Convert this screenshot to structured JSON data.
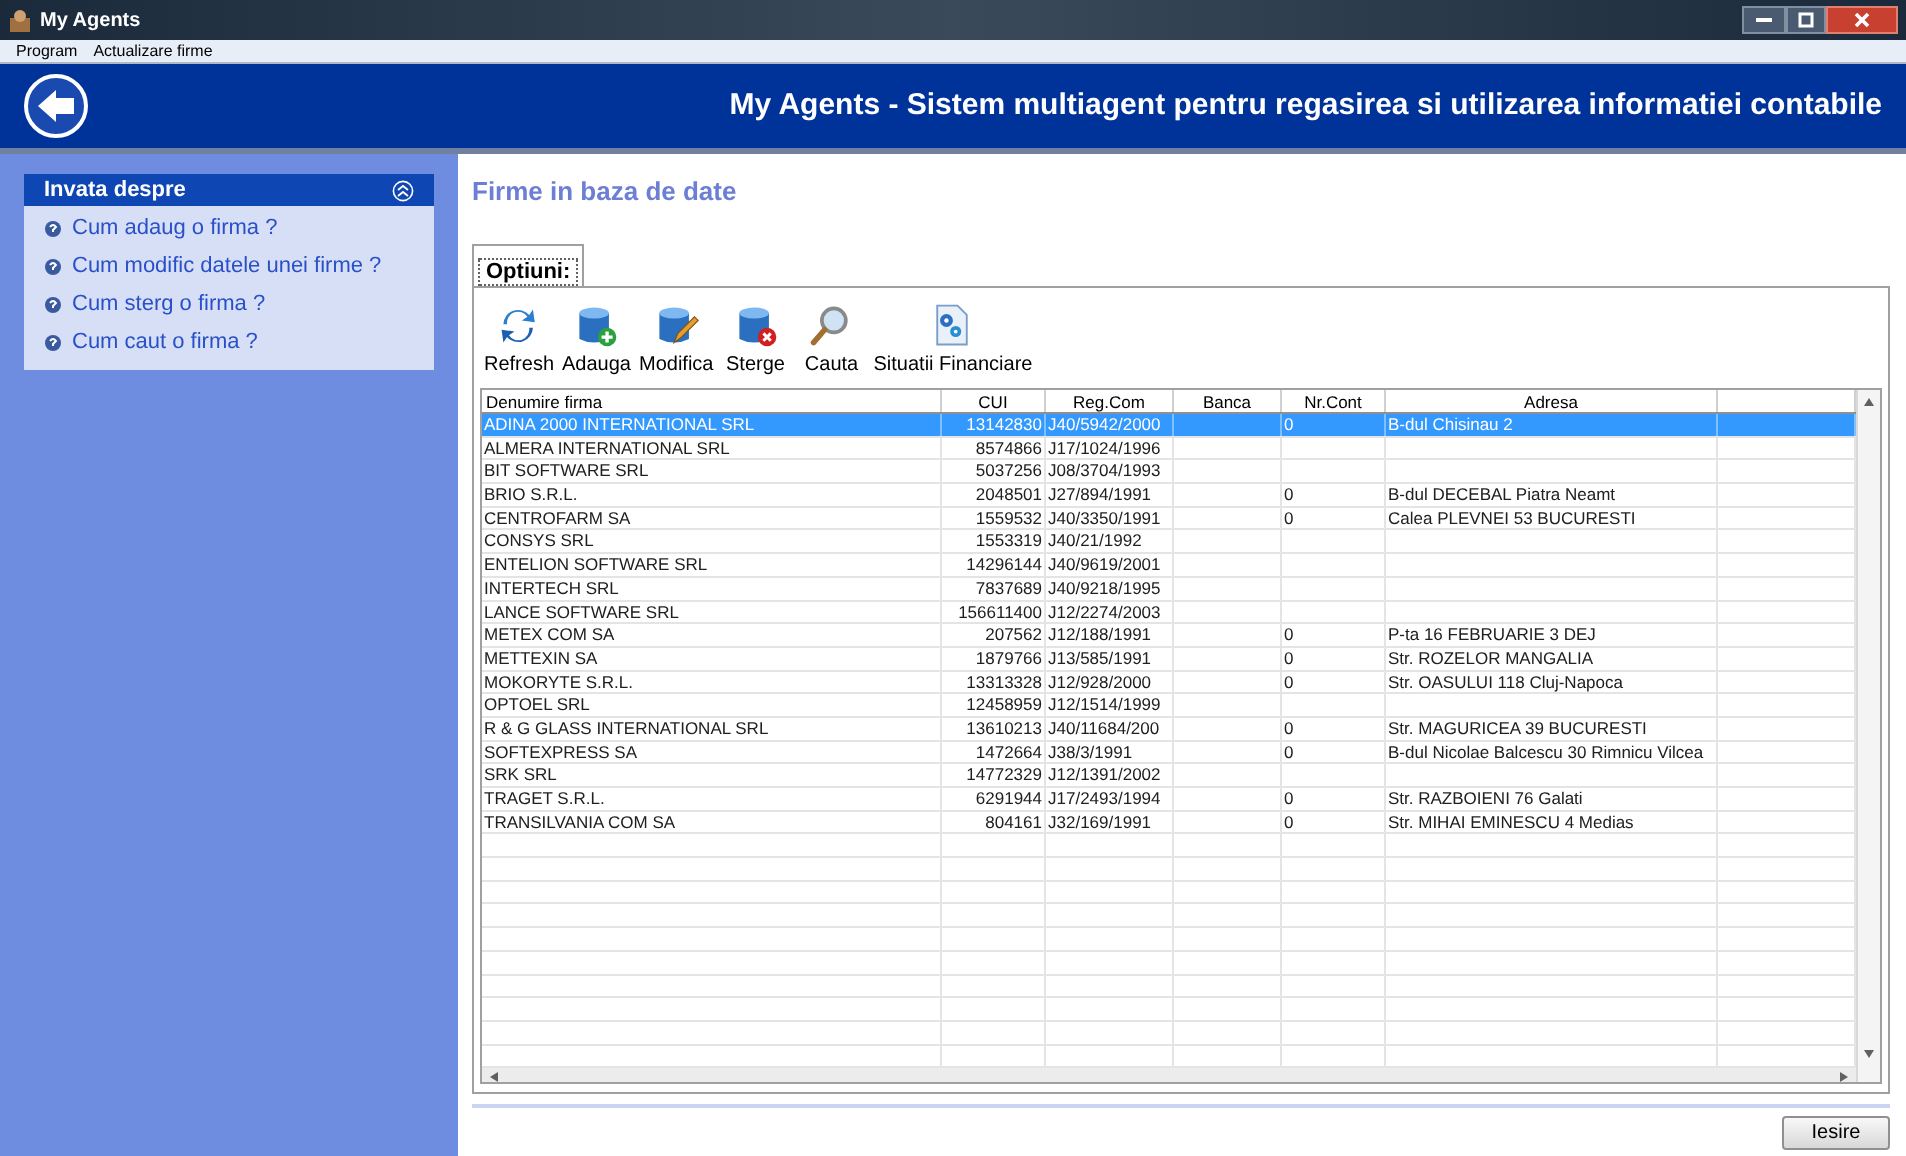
{
  "window": {
    "title": "My Agents"
  },
  "menu": [
    "Program",
    "Actualizare firme"
  ],
  "header": {
    "title": "My Agents - Sistem multiagent pentru regasirea si utilizarea informatiei contabile"
  },
  "sidebar": {
    "title": "Invata despre",
    "expanded": true,
    "links": [
      "Cum adaug o firma ?",
      "Cum modific datele unei firme ?",
      "Cum sterg o firma ?",
      "Cum caut o firma ?"
    ]
  },
  "page_title": "Firme in baza de date",
  "tabs": [
    {
      "label": "Optiuni:",
      "selected": true
    }
  ],
  "toolbar": [
    "Refresh",
    "Adauga",
    "Modifica",
    "Sterge",
    "Cauta",
    "Situatii Financiare"
  ],
  "table": {
    "columns": [
      "Denumire firma",
      "CUI",
      "Reg.Com",
      "Banca",
      "Nr.Cont",
      "Adresa"
    ],
    "rows": [
      {
        "name": "ADINA 2000 INTERNATIONAL SRL",
        "cui": "13142830",
        "reg_com": "J40/5942/2000",
        "nr_cont": "0",
        "adresa": "B-dul Chisinau 2",
        "selected": true
      },
      {
        "name": "ALMERA INTERNATIONAL SRL",
        "cui": "8574866",
        "reg_com": "J17/1024/1996",
        "selected": false
      },
      {
        "name": "BIT SOFTWARE SRL",
        "cui": "5037256",
        "reg_com": "J08/3704/1993",
        "selected": false
      },
      {
        "name": "BRIO S.R.L.",
        "cui": "2048501",
        "reg_com": "J27/894/1991",
        "nr_cont": "0",
        "adresa": "B-dul DECEBAL Piatra Neamt",
        "selected": false
      },
      {
        "name": "CENTROFARM SA",
        "cui": "1559532",
        "reg_com": "J40/3350/1991",
        "nr_cont": "0",
        "adresa": "Calea PLEVNEI 53 BUCURESTI",
        "selected": false
      },
      {
        "name": "CONSYS SRL",
        "cui": "1553319",
        "reg_com": "J40/21/1992",
        "selected": false
      },
      {
        "name": "ENTELION SOFTWARE SRL",
        "cui": "14296144",
        "reg_com": "J40/9619/2001",
        "selected": false
      },
      {
        "name": "INTERTECH SRL",
        "cui": "7837689",
        "reg_com": "J40/9218/1995",
        "selected": false
      },
      {
        "name": "LANCE SOFTWARE SRL",
        "cui": "156611400",
        "reg_com": "J12/2274/2003",
        "selected": false
      },
      {
        "name": "METEX COM SA",
        "cui": "207562",
        "reg_com": "J12/188/1991",
        "nr_cont": "0",
        "adresa": "P-ta 16 FEBRUARIE 3 DEJ",
        "selected": false
      },
      {
        "name": "METTEXIN SA",
        "cui": "1879766",
        "reg_com": "J13/585/1991",
        "nr_cont": "0",
        "adresa": "Str. ROZELOR MANGALIA",
        "selected": false
      },
      {
        "name": "MOKORYTE S.R.L.",
        "cui": "13313328",
        "reg_com": "J12/928/2000",
        "nr_cont": "0",
        "adresa": "Str. OASULUI 118 Cluj-Napoca",
        "selected": false
      },
      {
        "name": "OPTOEL SRL",
        "cui": "12458959",
        "reg_com": "J12/1514/1999",
        "selected": false
      },
      {
        "name": "R & G GLASS INTERNATIONAL SRL",
        "cui": "13610213",
        "reg_com": "J40/11684/200",
        "nr_cont": "0",
        "adresa": "Str. MAGURICEA 39 BUCURESTI",
        "selected": false
      },
      {
        "name": "SOFTEXPRESS SA",
        "cui": "1472664",
        "reg_com": "J38/3/1991",
        "nr_cont": "0",
        "adresa": "B-dul Nicolae Balcescu 30 Rimnicu Vilcea",
        "selected": false
      },
      {
        "name": "SRK SRL",
        "cui": "14772329",
        "reg_com": "J12/1391/2002",
        "selected": false
      },
      {
        "name": "TRAGET S.R.L.",
        "cui": "6291944",
        "reg_com": "J17/2493/1994",
        "nr_cont": "0",
        "adresa": "Str. RAZBOIENI 76 Galati",
        "selected": false
      },
      {
        "name": "TRANSILVANIA COM SA",
        "cui": "804161",
        "reg_com": "J32/169/1991",
        "nr_cont": "0",
        "adresa": "Str. MIHAI EMINESCU 4 Medias",
        "selected": false
      }
    ]
  },
  "exit_button": "Iesire"
}
